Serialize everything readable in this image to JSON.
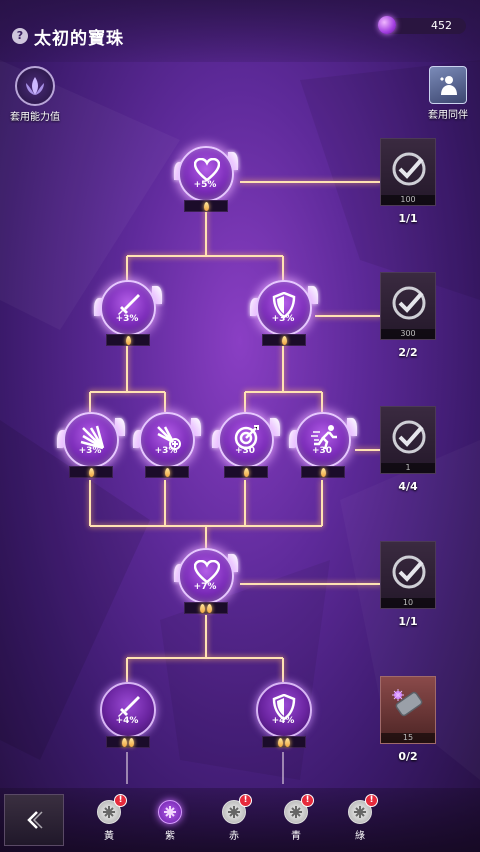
{
  "header": {
    "title": "太初的寶珠",
    "help_icon": "?",
    "currency_value": "452",
    "currency_icon": "purple-gem-icon"
  },
  "buttons": {
    "apply_ability_label": "套用能力值",
    "apply_companion_label": "套用同伴"
  },
  "nodes": [
    {
      "id": "heart-top",
      "icon": "heart-icon",
      "value": "+5%",
      "pips": 1
    },
    {
      "id": "sword-mid",
      "icon": "sword-icon",
      "value": "+3%",
      "pips": 1
    },
    {
      "id": "shield-mid",
      "icon": "shield-icon",
      "value": "+3%",
      "pips": 1
    },
    {
      "id": "burst-a",
      "icon": "burst-icon",
      "value": "+3%",
      "pips": 1
    },
    {
      "id": "burst-plus",
      "icon": "burst-plus-icon",
      "value": "+3%",
      "pips": 1
    },
    {
      "id": "target",
      "icon": "target-icon",
      "value": "+30",
      "pips": 1
    },
    {
      "id": "run",
      "icon": "running-icon",
      "value": "+30",
      "pips": 1
    },
    {
      "id": "heart-lower",
      "icon": "heart-icon",
      "value": "+7%",
      "pips": 2
    },
    {
      "id": "sword-bottom",
      "icon": "sword-icon",
      "value": "+4%",
      "pips": 2
    },
    {
      "id": "shield-bottom",
      "icon": "shield-icon",
      "value": "+4%",
      "pips": 2
    }
  ],
  "rewards": [
    {
      "icon": "checkmark-icon",
      "count": "100",
      "progress": "1/1"
    },
    {
      "icon": "checkmark-icon",
      "count": "300",
      "progress": "2/2"
    },
    {
      "icon": "checkmark-icon",
      "count": "1",
      "progress": "4/4"
    },
    {
      "icon": "checkmark-icon",
      "count": "10",
      "progress": "1/1"
    },
    {
      "icon": "scroll-item-icon",
      "count": "15",
      "progress": "0/2"
    }
  ],
  "tabs": [
    {
      "label": "黃",
      "badge": "!",
      "selected": false
    },
    {
      "label": "紫",
      "badge": "",
      "selected": true
    },
    {
      "label": "赤",
      "badge": "!",
      "selected": false
    },
    {
      "label": "青",
      "badge": "!",
      "selected": false
    },
    {
      "label": "綠",
      "badge": "!",
      "selected": false
    }
  ],
  "colors": {
    "accent_purple": "#8a3fc4",
    "glow_line": "#ffd6a0",
    "badge_red": "#e62a3c"
  }
}
